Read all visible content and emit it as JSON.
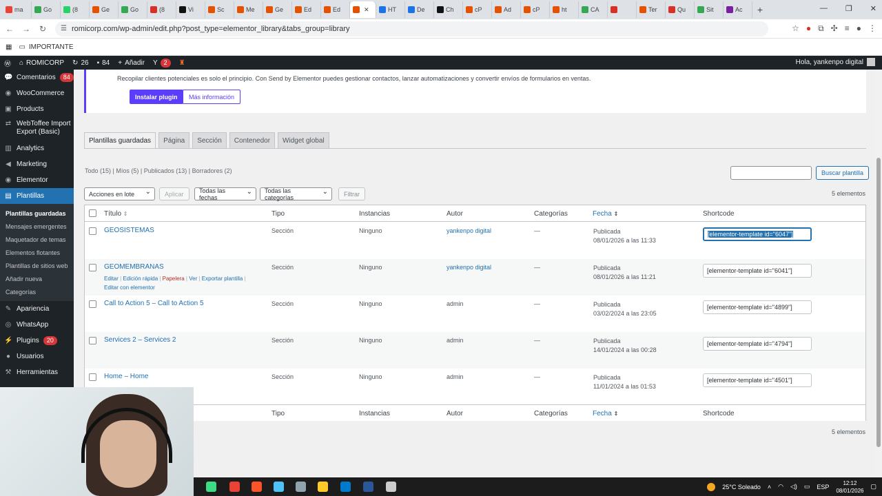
{
  "browser": {
    "tabs": [
      {
        "label": "ma",
        "color": "#ea4335"
      },
      {
        "label": "Go",
        "color": "#34a853"
      },
      {
        "label": "(8",
        "color": "#25d366"
      },
      {
        "label": "Ge",
        "color": "#e65100"
      },
      {
        "label": "Go",
        "color": "#34a853"
      },
      {
        "label": "(8",
        "color": "#d93025"
      },
      {
        "label": "Vi",
        "color": "#111111"
      },
      {
        "label": "Sc",
        "color": "#e65100"
      },
      {
        "label": "Me",
        "color": "#e65100"
      },
      {
        "label": "Ge",
        "color": "#e65100"
      },
      {
        "label": "Ed",
        "color": "#e65100"
      },
      {
        "label": "Ed",
        "color": "#e65100"
      },
      {
        "label": "",
        "color": "#e65100"
      },
      {
        "label": "HT",
        "color": "#1a73e8"
      },
      {
        "label": "De",
        "color": "#1a73e8"
      },
      {
        "label": "Ch",
        "color": "#111111"
      },
      {
        "label": "cP",
        "color": "#e65100"
      },
      {
        "label": "Ad",
        "color": "#e65100"
      },
      {
        "label": "cP",
        "color": "#e65100"
      },
      {
        "label": "ht",
        "color": "#e65100"
      },
      {
        "label": "CA",
        "color": "#34a853"
      },
      {
        "label": "",
        "color": "#d93025"
      },
      {
        "label": "Ter",
        "color": "#e65100"
      },
      {
        "label": "Qu",
        "color": "#d93025"
      },
      {
        "label": "Sit",
        "color": "#34a853"
      },
      {
        "label": "Ac",
        "color": "#7b1fa2"
      }
    ],
    "active_tab_index": 12,
    "url": "romicorp.com/wp-admin/edit.php?post_type=elementor_library&tabs_group=library",
    "bookmark": "IMPORTANTE"
  },
  "adminbar": {
    "site": "ROMICORP",
    "updates": "26",
    "comments": "84",
    "add": "Añadir",
    "yoast_count": "2",
    "howdy": "Hola, yankenpo digital"
  },
  "sidemenu": {
    "items": [
      {
        "label": "Comentarios",
        "icon": "comment-icon",
        "glyph": "💬",
        "badge": "84"
      },
      {
        "label": "WooCommerce",
        "icon": "woo-icon",
        "glyph": "◉"
      },
      {
        "label": "Products",
        "icon": "box-icon",
        "glyph": "▣"
      },
      {
        "label": "WebToffee Import Export (Basic)",
        "icon": "import-icon",
        "glyph": "⇄"
      },
      {
        "label": "Analytics",
        "icon": "chart-icon",
        "glyph": "▥"
      },
      {
        "label": "Marketing",
        "icon": "megaphone-icon",
        "glyph": "◀"
      },
      {
        "label": "Elementor",
        "icon": "elementor-icon",
        "glyph": "◉"
      },
      {
        "label": "Plantillas",
        "icon": "folder-icon",
        "glyph": "▤",
        "current": true
      }
    ],
    "submenu": [
      {
        "label": "Plantillas guardadas",
        "current": true
      },
      {
        "label": "Mensajes emergentes"
      },
      {
        "label": "Maquetador de temas"
      },
      {
        "label": "Elementos flotantes"
      },
      {
        "label": "Plantillas de sitios web"
      },
      {
        "label": "Añadir nueva"
      },
      {
        "label": "Categorías"
      }
    ],
    "after": [
      {
        "label": "Apariencia",
        "icon": "brush-icon",
        "glyph": "✎"
      },
      {
        "label": "WhatsApp",
        "icon": "whatsapp-icon",
        "glyph": "◎"
      },
      {
        "label": "Plugins",
        "icon": "plugin-icon",
        "glyph": "⚡",
        "badge": "20"
      },
      {
        "label": "Usuarios",
        "icon": "user-icon",
        "glyph": "●"
      },
      {
        "label": "Herramientas",
        "icon": "wrench-icon",
        "glyph": "⚒"
      }
    ]
  },
  "notice": {
    "message": "Recopilar clientes potenciales es solo el principio. Con Send by Elementor puedes gestionar contactos, lanzar automatizaciones y convertir envíos de formularios en ventas.",
    "install": "Instalar plugin",
    "more": "Más información"
  },
  "tabs": [
    "Plantillas guardadas",
    "Página",
    "Sección",
    "Contenedor",
    "Widget global"
  ],
  "filters": {
    "links": "Todo (15) | Míos (5) | Publicados (13) | Borradores (2)",
    "search_button": "Buscar plantilla",
    "bulk": "Acciones en lote",
    "apply": "Aplicar",
    "dates": "Todas las fechas",
    "categories": "Todas las categorías",
    "filter": "Filtrar",
    "count": "5 elementos"
  },
  "table": {
    "headers": {
      "title": "Título",
      "title_sort": "⇕",
      "tipo": "Tipo",
      "instancias": "Instancias",
      "autor": "Autor",
      "categorias": "Categorías",
      "fecha": "Fecha",
      "fecha_sort": "⇕",
      "shortcode": "Shortcode"
    },
    "rows": [
      {
        "title": "GEOSISTEMAS",
        "tipo": "Sección",
        "inst": "Ninguno",
        "autor": "yankenpo digital",
        "cat": "—",
        "status": "Publicada",
        "date": "08/01/2026 a las 11:33",
        "shortcode": "[elementor-template id=\"6047\"]",
        "selected": true
      },
      {
        "title": "GEOMEMBRANAS",
        "tipo": "Sección",
        "inst": "Ninguno",
        "autor": "yankenpo digital",
        "cat": "—",
        "status": "Publicada",
        "date": "08/01/2026 a las 11:21",
        "shortcode": "[elementor-template id=\"6041\"]",
        "actions": {
          "edit": "Editar",
          "quick": "Edición rápida",
          "trash": "Papelera",
          "view": "Ver",
          "export": "Exportar plantilla",
          "elementor": "Editar con elementor"
        }
      },
      {
        "title": "Call to Action 5 – Call to Action 5",
        "tipo": "Sección",
        "inst": "Ninguno",
        "autor": "admin",
        "cat": "—",
        "status": "Publicada",
        "date": "03/02/2024 a las 23:05",
        "shortcode": "[elementor-template id=\"4899\"]"
      },
      {
        "title": "Services 2 – Services 2",
        "tipo": "Sección",
        "inst": "Ninguno",
        "autor": "admin",
        "cat": "—",
        "status": "Publicada",
        "date": "14/01/2024 a las 00:28",
        "shortcode": "[elementor-template id=\"4794\"]"
      },
      {
        "title": "Home – Home",
        "tipo": "Sección",
        "inst": "Ninguno",
        "autor": "admin",
        "cat": "—",
        "status": "Publicada",
        "date": "11/01/2024 a las 01:53",
        "shortcode": "[elementor-template id=\"4501\"]"
      }
    ],
    "footer_count": "5 elementos"
  },
  "taskbar": {
    "apps": [
      {
        "icon": "android-studio-icon",
        "color": "#3ddc84"
      },
      {
        "icon": "chrome-icon",
        "color": "#ea4335"
      },
      {
        "icon": "brave-icon",
        "color": "#fb542b"
      },
      {
        "icon": "files-icon",
        "color": "#4fc3f7"
      },
      {
        "icon": "settings-icon",
        "color": "#90a4ae"
      },
      {
        "icon": "folder-icon",
        "color": "#ffca28"
      },
      {
        "icon": "vscode-icon",
        "color": "#007acc"
      },
      {
        "icon": "word-icon",
        "color": "#2b579a"
      },
      {
        "icon": "obs-icon",
        "color": "#cccccc"
      }
    ],
    "weather": "25°C Soleado",
    "lang": "ESP",
    "time": "12:12",
    "date": "08/01/2026"
  }
}
